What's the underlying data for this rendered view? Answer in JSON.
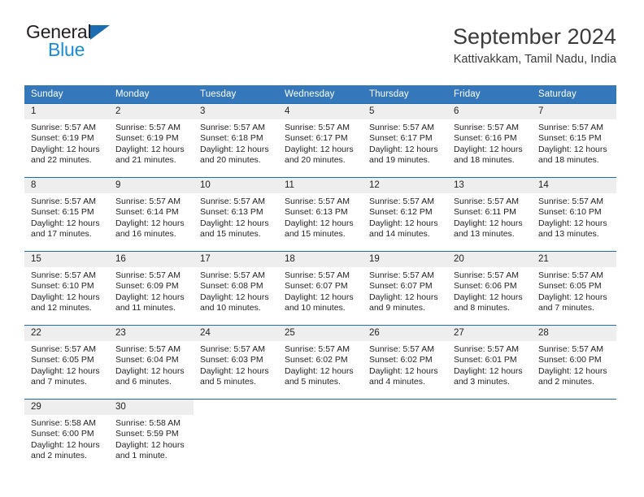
{
  "brand": {
    "name_top": "General",
    "name_bottom": "Blue",
    "accent_dark": "#1b6cb0",
    "accent_light": "#1b8cdb"
  },
  "header": {
    "title": "September 2024",
    "location": "Kattivakkam, Tamil Nadu, India"
  },
  "theme": {
    "header_row_bg": "#3577bb",
    "daynum_bg": "#eeeeee",
    "row_divider": "#1b6cb0",
    "text": "#231f20"
  },
  "weekday_headers": [
    "Sunday",
    "Monday",
    "Tuesday",
    "Wednesday",
    "Thursday",
    "Friday",
    "Saturday"
  ],
  "weeks": [
    [
      {
        "day": "1",
        "sunrise": "Sunrise: 5:57 AM",
        "sunset": "Sunset: 6:19 PM",
        "daylight1": "Daylight: 12 hours",
        "daylight2": "and 22 minutes."
      },
      {
        "day": "2",
        "sunrise": "Sunrise: 5:57 AM",
        "sunset": "Sunset: 6:19 PM",
        "daylight1": "Daylight: 12 hours",
        "daylight2": "and 21 minutes."
      },
      {
        "day": "3",
        "sunrise": "Sunrise: 5:57 AM",
        "sunset": "Sunset: 6:18 PM",
        "daylight1": "Daylight: 12 hours",
        "daylight2": "and 20 minutes."
      },
      {
        "day": "4",
        "sunrise": "Sunrise: 5:57 AM",
        "sunset": "Sunset: 6:17 PM",
        "daylight1": "Daylight: 12 hours",
        "daylight2": "and 20 minutes."
      },
      {
        "day": "5",
        "sunrise": "Sunrise: 5:57 AM",
        "sunset": "Sunset: 6:17 PM",
        "daylight1": "Daylight: 12 hours",
        "daylight2": "and 19 minutes."
      },
      {
        "day": "6",
        "sunrise": "Sunrise: 5:57 AM",
        "sunset": "Sunset: 6:16 PM",
        "daylight1": "Daylight: 12 hours",
        "daylight2": "and 18 minutes."
      },
      {
        "day": "7",
        "sunrise": "Sunrise: 5:57 AM",
        "sunset": "Sunset: 6:15 PM",
        "daylight1": "Daylight: 12 hours",
        "daylight2": "and 18 minutes."
      }
    ],
    [
      {
        "day": "8",
        "sunrise": "Sunrise: 5:57 AM",
        "sunset": "Sunset: 6:15 PM",
        "daylight1": "Daylight: 12 hours",
        "daylight2": "and 17 minutes."
      },
      {
        "day": "9",
        "sunrise": "Sunrise: 5:57 AM",
        "sunset": "Sunset: 6:14 PM",
        "daylight1": "Daylight: 12 hours",
        "daylight2": "and 16 minutes."
      },
      {
        "day": "10",
        "sunrise": "Sunrise: 5:57 AM",
        "sunset": "Sunset: 6:13 PM",
        "daylight1": "Daylight: 12 hours",
        "daylight2": "and 15 minutes."
      },
      {
        "day": "11",
        "sunrise": "Sunrise: 5:57 AM",
        "sunset": "Sunset: 6:13 PM",
        "daylight1": "Daylight: 12 hours",
        "daylight2": "and 15 minutes."
      },
      {
        "day": "12",
        "sunrise": "Sunrise: 5:57 AM",
        "sunset": "Sunset: 6:12 PM",
        "daylight1": "Daylight: 12 hours",
        "daylight2": "and 14 minutes."
      },
      {
        "day": "13",
        "sunrise": "Sunrise: 5:57 AM",
        "sunset": "Sunset: 6:11 PM",
        "daylight1": "Daylight: 12 hours",
        "daylight2": "and 13 minutes."
      },
      {
        "day": "14",
        "sunrise": "Sunrise: 5:57 AM",
        "sunset": "Sunset: 6:10 PM",
        "daylight1": "Daylight: 12 hours",
        "daylight2": "and 13 minutes."
      }
    ],
    [
      {
        "day": "15",
        "sunrise": "Sunrise: 5:57 AM",
        "sunset": "Sunset: 6:10 PM",
        "daylight1": "Daylight: 12 hours",
        "daylight2": "and 12 minutes."
      },
      {
        "day": "16",
        "sunrise": "Sunrise: 5:57 AM",
        "sunset": "Sunset: 6:09 PM",
        "daylight1": "Daylight: 12 hours",
        "daylight2": "and 11 minutes."
      },
      {
        "day": "17",
        "sunrise": "Sunrise: 5:57 AM",
        "sunset": "Sunset: 6:08 PM",
        "daylight1": "Daylight: 12 hours",
        "daylight2": "and 10 minutes."
      },
      {
        "day": "18",
        "sunrise": "Sunrise: 5:57 AM",
        "sunset": "Sunset: 6:07 PM",
        "daylight1": "Daylight: 12 hours",
        "daylight2": "and 10 minutes."
      },
      {
        "day": "19",
        "sunrise": "Sunrise: 5:57 AM",
        "sunset": "Sunset: 6:07 PM",
        "daylight1": "Daylight: 12 hours",
        "daylight2": "and 9 minutes."
      },
      {
        "day": "20",
        "sunrise": "Sunrise: 5:57 AM",
        "sunset": "Sunset: 6:06 PM",
        "daylight1": "Daylight: 12 hours",
        "daylight2": "and 8 minutes."
      },
      {
        "day": "21",
        "sunrise": "Sunrise: 5:57 AM",
        "sunset": "Sunset: 6:05 PM",
        "daylight1": "Daylight: 12 hours",
        "daylight2": "and 7 minutes."
      }
    ],
    [
      {
        "day": "22",
        "sunrise": "Sunrise: 5:57 AM",
        "sunset": "Sunset: 6:05 PM",
        "daylight1": "Daylight: 12 hours",
        "daylight2": "and 7 minutes."
      },
      {
        "day": "23",
        "sunrise": "Sunrise: 5:57 AM",
        "sunset": "Sunset: 6:04 PM",
        "daylight1": "Daylight: 12 hours",
        "daylight2": "and 6 minutes."
      },
      {
        "day": "24",
        "sunrise": "Sunrise: 5:57 AM",
        "sunset": "Sunset: 6:03 PM",
        "daylight1": "Daylight: 12 hours",
        "daylight2": "and 5 minutes."
      },
      {
        "day": "25",
        "sunrise": "Sunrise: 5:57 AM",
        "sunset": "Sunset: 6:02 PM",
        "daylight1": "Daylight: 12 hours",
        "daylight2": "and 5 minutes."
      },
      {
        "day": "26",
        "sunrise": "Sunrise: 5:57 AM",
        "sunset": "Sunset: 6:02 PM",
        "daylight1": "Daylight: 12 hours",
        "daylight2": "and 4 minutes."
      },
      {
        "day": "27",
        "sunrise": "Sunrise: 5:57 AM",
        "sunset": "Sunset: 6:01 PM",
        "daylight1": "Daylight: 12 hours",
        "daylight2": "and 3 minutes."
      },
      {
        "day": "28",
        "sunrise": "Sunrise: 5:57 AM",
        "sunset": "Sunset: 6:00 PM",
        "daylight1": "Daylight: 12 hours",
        "daylight2": "and 2 minutes."
      }
    ],
    [
      {
        "day": "29",
        "sunrise": "Sunrise: 5:58 AM",
        "sunset": "Sunset: 6:00 PM",
        "daylight1": "Daylight: 12 hours",
        "daylight2": "and 2 minutes."
      },
      {
        "day": "30",
        "sunrise": "Sunrise: 5:58 AM",
        "sunset": "Sunset: 5:59 PM",
        "daylight1": "Daylight: 12 hours",
        "daylight2": "and 1 minute."
      },
      {
        "day": "",
        "sunrise": "",
        "sunset": "",
        "daylight1": "",
        "daylight2": ""
      },
      {
        "day": "",
        "sunrise": "",
        "sunset": "",
        "daylight1": "",
        "daylight2": ""
      },
      {
        "day": "",
        "sunrise": "",
        "sunset": "",
        "daylight1": "",
        "daylight2": ""
      },
      {
        "day": "",
        "sunrise": "",
        "sunset": "",
        "daylight1": "",
        "daylight2": ""
      },
      {
        "day": "",
        "sunrise": "",
        "sunset": "",
        "daylight1": "",
        "daylight2": ""
      }
    ]
  ]
}
